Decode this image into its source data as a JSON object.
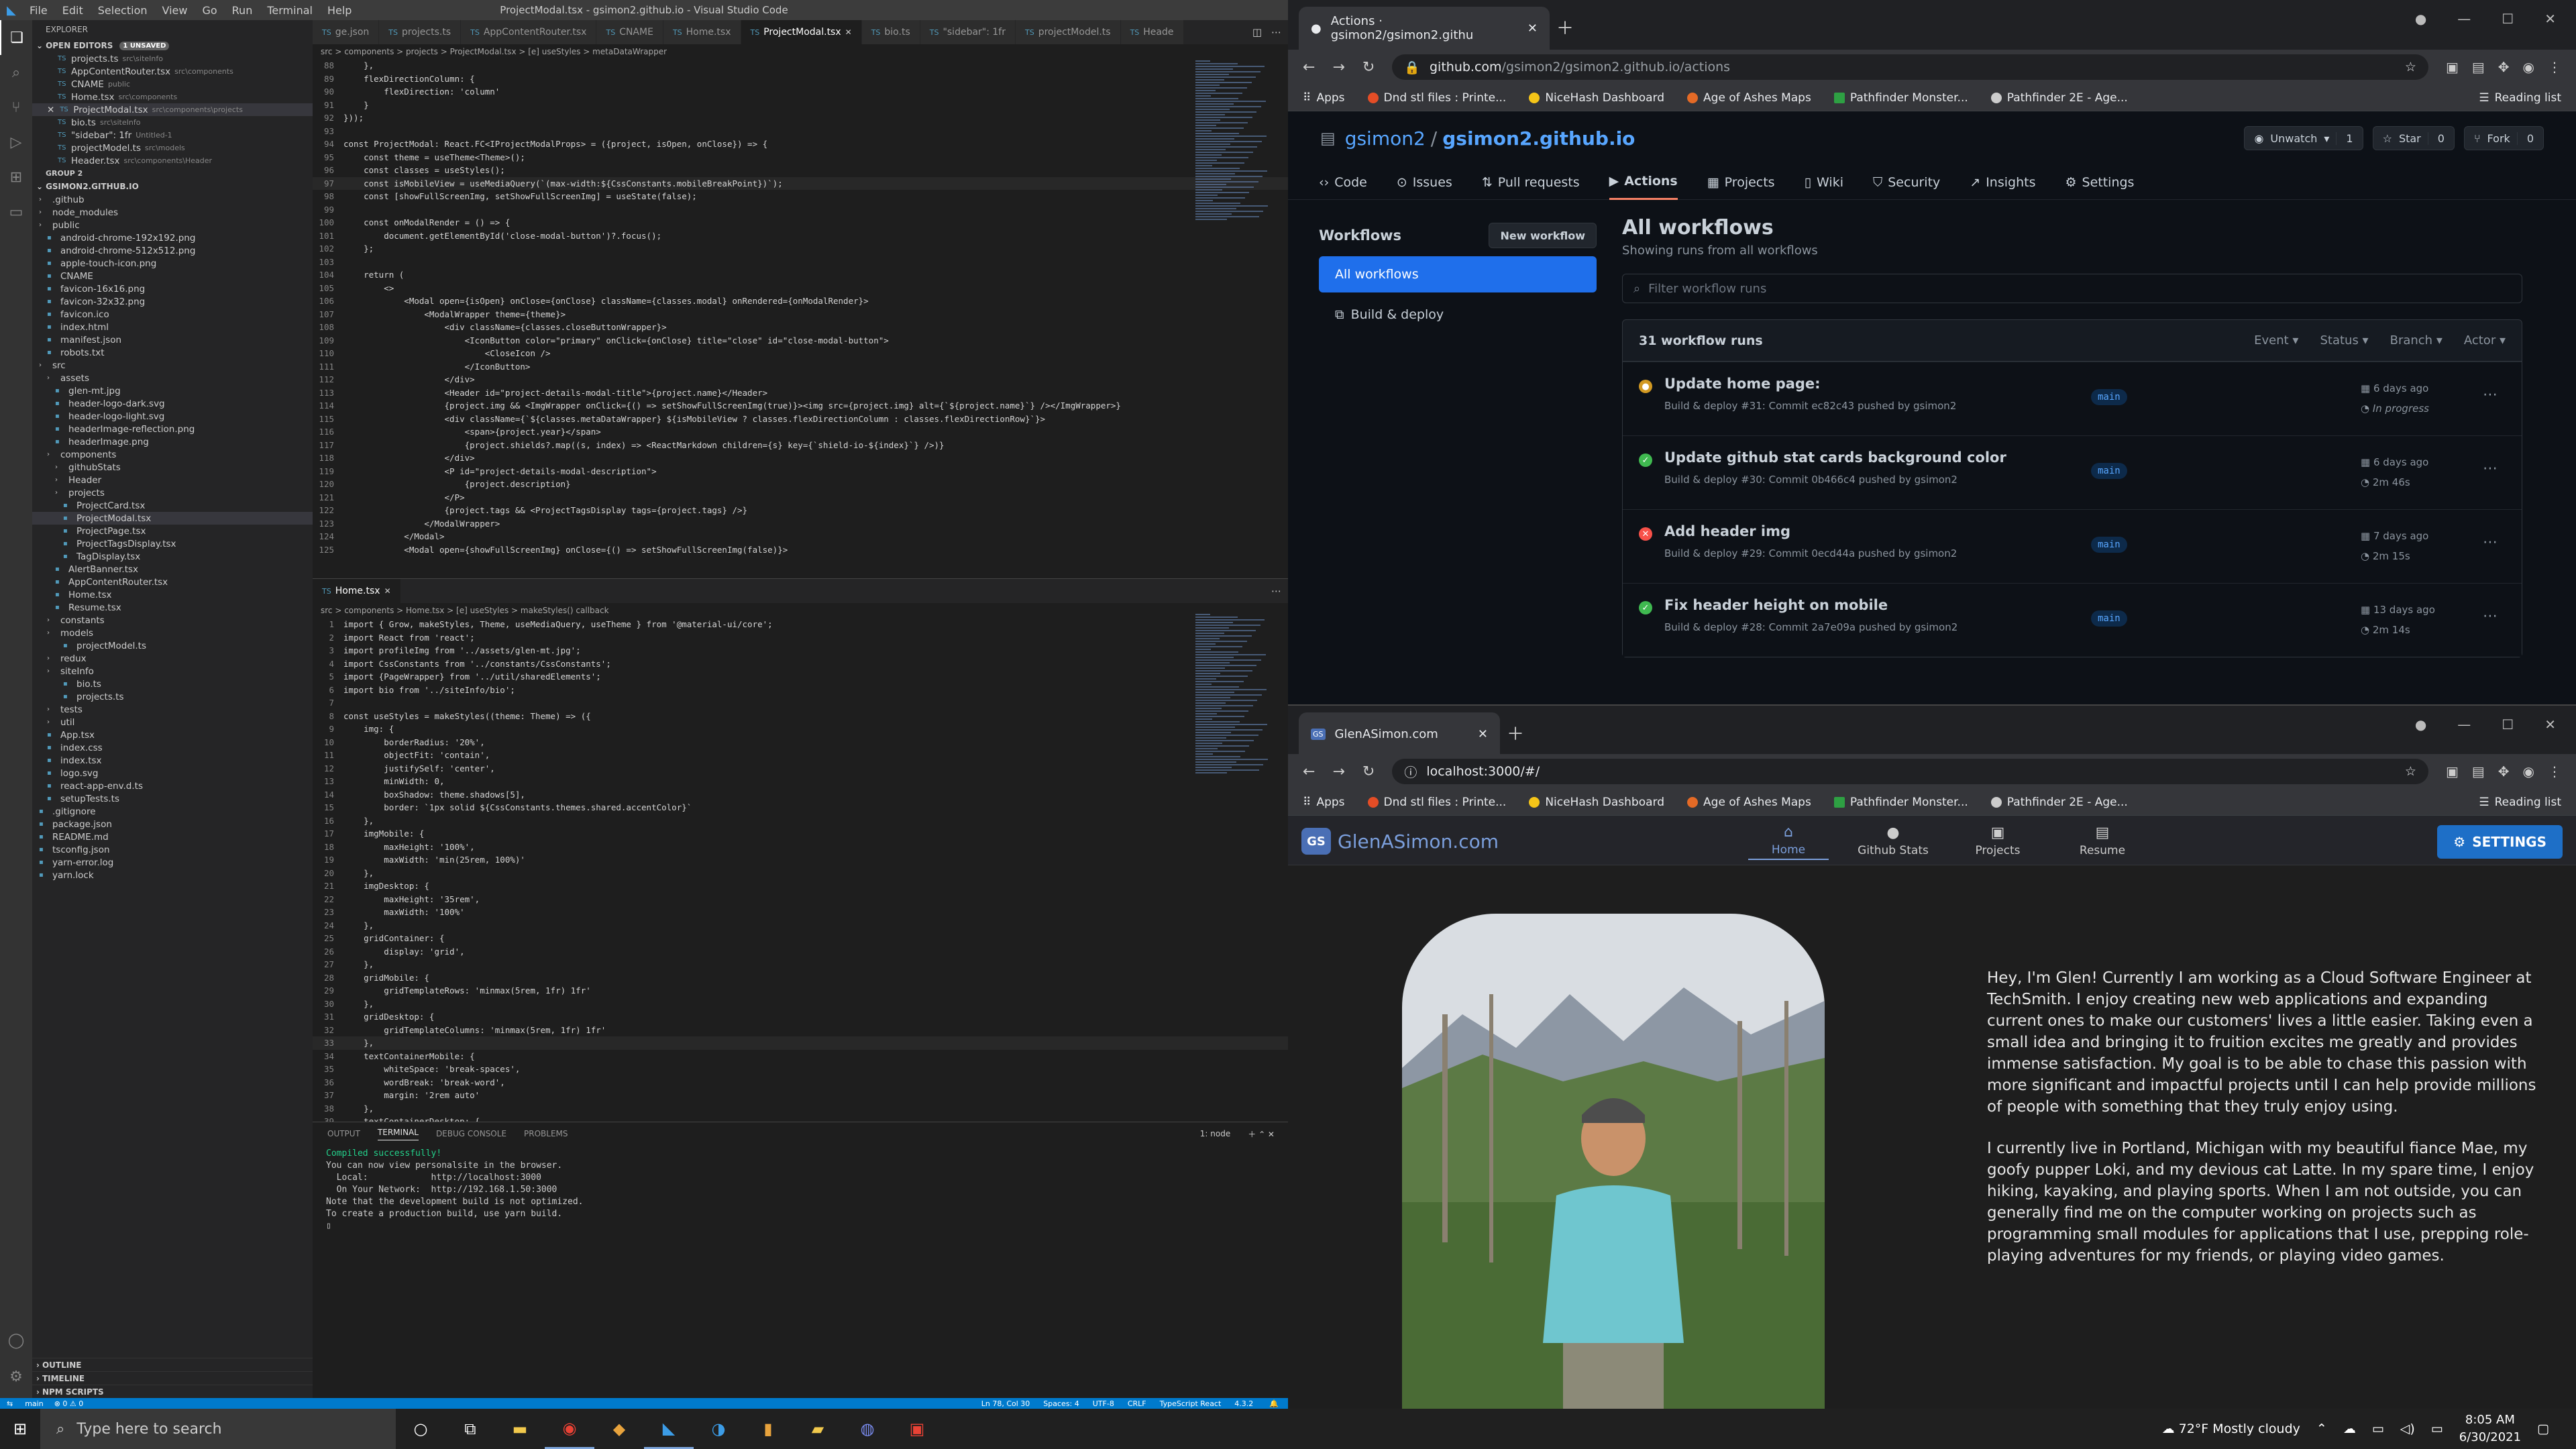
{
  "vscode": {
    "title": "ProjectModal.tsx - gsimon2.github.io - Visual Studio Code",
    "menu": [
      "File",
      "Edit",
      "Selection",
      "View",
      "Go",
      "Run",
      "Terminal",
      "Help"
    ],
    "explorer": "EXPLORER",
    "open_editors": "OPEN EDITORS",
    "unsaved": "1 UNSAVED",
    "open_files": [
      {
        "name": "projects.ts",
        "dir": "src\\siteInfo"
      },
      {
        "name": "AppContentRouter.tsx",
        "dir": "src\\components"
      },
      {
        "name": "CNAME",
        "dir": "public"
      },
      {
        "name": "Home.tsx",
        "dir": "src\\components"
      },
      {
        "name": "ProjectModal.tsx",
        "dir": "src\\components\\projects"
      },
      {
        "name": "bio.ts",
        "dir": "src\\siteInfo"
      },
      {
        "name": "\"sidebar\": 1fr",
        "dir": "Untitled-1"
      },
      {
        "name": "projectModel.ts",
        "dir": "src\\models"
      },
      {
        "name": "Header.tsx",
        "dir": "src\\components\\Header"
      }
    ],
    "group2": "GROUP 2",
    "repo": "GSIMON2.GITHUB.IO",
    "tree": [
      ".github",
      "node_modules",
      "public",
      "android-chrome-192x192.png",
      "android-chrome-512x512.png",
      "apple-touch-icon.png",
      "CNAME",
      "favicon-16x16.png",
      "favicon-32x32.png",
      "favicon.ico",
      "index.html",
      "manifest.json",
      "robots.txt",
      "src",
      "assets",
      "glen-mt.jpg",
      "header-logo-dark.svg",
      "header-logo-light.svg",
      "headerImage-reflection.png",
      "headerImage.png",
      "components",
      "githubStats",
      "Header",
      "projects",
      "ProjectCard.tsx",
      "ProjectModal.tsx",
      "ProjectPage.tsx",
      "ProjectTagsDisplay.tsx",
      "TagDisplay.tsx",
      "AlertBanner.tsx",
      "AppContentRouter.tsx",
      "Home.tsx",
      "Resume.tsx",
      "constants",
      "models",
      "projectModel.ts",
      "redux",
      "siteInfo",
      "bio.ts",
      "projects.ts",
      "tests",
      "util",
      "App.tsx",
      "index.css",
      "index.tsx",
      "logo.svg",
      "react-app-env.d.ts",
      "setupTests.ts",
      ".gitignore",
      "package.json",
      "README.md",
      "tsconfig.json",
      "yarn-error.log",
      "yarn.lock"
    ],
    "outline": "OUTLINE",
    "timeline": "TIMELINE",
    "npm": "NPM SCRIPTS",
    "tabs1": [
      "ge.json",
      "projects.ts",
      "AppContentRouter.tsx",
      "CNAME",
      "Home.tsx",
      "ProjectModal.tsx",
      "bio.ts",
      "\"sidebar\": 1fr",
      "projectModel.ts",
      "Heade"
    ],
    "crumb1": "src > components > projects > ProjectModal.tsx > [e] useStyles > metaDataWrapper",
    "code1_start": 88,
    "code1": [
      "    },",
      "    flexDirectionColumn: {",
      "        flexDirection: 'column'",
      "    }",
      "}));",
      "",
      "const ProjectModal: React.FC<IProjectModalProps> = ({project, isOpen, onClose}) => {",
      "    const theme = useTheme<Theme>();",
      "    const classes = useStyles();",
      "    const isMobileView = useMediaQuery(`(max-width:${CssConstants.mobileBreakPoint})`);",
      "    const [showFullScreenImg, setShowFullScreenImg] = useState(false);",
      "",
      "    const onModalRender = () => {",
      "        document.getElementById('close-modal-button')?.focus();",
      "    };",
      "",
      "    return (",
      "        <>",
      "            <Modal open={isOpen} onClose={onClose} className={classes.modal} onRendered={onModalRender}>",
      "                <ModalWrapper theme={theme}>",
      "                    <div className={classes.closeButtonWrapper}>",
      "                        <IconButton color=\"primary\" onClick={onClose} title=\"close\" id=\"close-modal-button\">",
      "                            <CloseIcon />",
      "                        </IconButton>",
      "                    </div>",
      "                    <Header id=\"project-details-modal-title\">{project.name}</Header>",
      "                    {project.img && <ImgWrapper onClick={() => setShowFullScreenImg(true)}><img src={project.img} alt={`${project.name}`} /></ImgWrapper>}",
      "                    <div className={`${classes.metaDataWrapper} ${isMobileView ? classes.flexDirectionColumn : classes.flexDirectionRow}`}>",
      "                        <span>{project.year}</span>",
      "                        {project.shields?.map((s, index) => <ReactMarkdown children={s} key={`shield-io-${index}`} />)}",
      "                    </div>",
      "                    <P id=\"project-details-modal-description\">",
      "                        {project.description}",
      "                    </P>",
      "                    {project.tags && <ProjectTagsDisplay tags={project.tags} />}",
      "                </ModalWrapper>",
      "            </Modal>",
      "            <Modal open={showFullScreenImg} onClose={() => setShowFullScreenImg(false)}>"
    ],
    "tab2": "Home.tsx",
    "crumb2": "src > components > Home.tsx > [e] useStyles > makeStyles() callback",
    "code2_start": 1,
    "code2": [
      "import { Grow, makeStyles, Theme, useMediaQuery, useTheme } from '@material-ui/core';",
      "import React from 'react';",
      "import profileImg from '../assets/glen-mt.jpg';",
      "import CssConstants from '../constants/CssConstants';",
      "import {PageWrapper} from '../util/sharedElements';",
      "import bio from '../siteInfo/bio';",
      "",
      "const useStyles = makeStyles((theme: Theme) => ({",
      "    img: {",
      "        borderRadius: '20%',",
      "        objectFit: 'contain',",
      "        justifySelf: 'center',",
      "        minWidth: 0,",
      "        boxShadow: theme.shadows[5],",
      "        border: `1px solid ${CssConstants.themes.shared.accentColor}`",
      "    },",
      "    imgMobile: {",
      "        maxHeight: '100%',",
      "        maxWidth: 'min(25rem, 100%)'",
      "    },",
      "    imgDesktop: {",
      "        maxHeight: '35rem',",
      "        maxWidth: '100%'",
      "    },",
      "    gridContainer: {",
      "        display: 'grid',",
      "    },",
      "    gridMobile: {",
      "        gridTemplateRows: 'minmax(5rem, 1fr) 1fr'",
      "    },",
      "    gridDesktop: {",
      "        gridTemplateColumns: 'minmax(5rem, 1fr) 1fr'",
      "    },",
      "    textContainerMobile: {",
      "        whiteSpace: 'break-spaces',",
      "        wordBreak: 'break-word',",
      "        margin: '2rem auto'",
      "    },",
      "    textContainerDesktop: {"
    ],
    "panel_tabs": [
      "OUTPUT",
      "TERMINAL",
      "DEBUG CONSOLE",
      "PROBLEMS"
    ],
    "panel_shell": "1: node",
    "terminal": [
      "Compiled successfully!",
      "",
      "You can now view personalsite in the browser.",
      "",
      "  Local:            http://localhost:3000",
      "  On Your Network:  http://192.168.1.50:3000",
      "",
      "Note that the development build is not optimized.",
      "To create a production build, use yarn build.",
      "",
      "▯"
    ],
    "status_left": [
      "main",
      "⊗ 0 ⚠ 0"
    ],
    "status_right": [
      "Ln 78, Col 30",
      "Spaces: 4",
      "UTF-8",
      "CRLF",
      "TypeScript React",
      "4.3.2"
    ]
  },
  "github": {
    "tab_title": "Actions · gsimon2/gsimon2.githu",
    "url_host": "github.com",
    "url_path": "/gsimon2/gsimon2.github.io/actions",
    "bookmarks": [
      "Apps",
      "Dnd stl files : Printe...",
      "NiceHash Dashboard",
      "Age of Ashes Maps",
      "Pathfinder Monster...",
      "Pathfinder 2E - Age..."
    ],
    "reading_list": "Reading list",
    "owner": "gsimon2",
    "repo": "gsimon2.github.io",
    "unwatch": "Unwatch",
    "watch_count": "1",
    "star": "Star",
    "star_count": "0",
    "fork": "Fork",
    "fork_count": "0",
    "nav": [
      "Code",
      "Issues",
      "Pull requests",
      "Actions",
      "Projects",
      "Wiki",
      "Security",
      "Insights",
      "Settings"
    ],
    "workflows_title": "Workflows",
    "new_workflow": "New workflow",
    "workflows": [
      "All workflows",
      "Build & deploy"
    ],
    "heading": "All workflows",
    "subheading": "Showing runs from all workflows",
    "filter_placeholder": "Filter workflow runs",
    "run_count": "31 workflow runs",
    "filters": [
      "Event",
      "Status",
      "Branch",
      "Actor"
    ],
    "runs": [
      {
        "title": "Update home page:",
        "sub": "Build & deploy #31: Commit ec82c43 pushed by gsimon2",
        "branch": "main",
        "date": "6 days ago",
        "dur": "In progress",
        "status": "progress"
      },
      {
        "title": "Update github stat cards background color",
        "sub": "Build & deploy #30: Commit 0b466c4 pushed by gsimon2",
        "branch": "main",
        "date": "6 days ago",
        "dur": "2m 46s",
        "status": "success"
      },
      {
        "title": "Add header img",
        "sub": "Build & deploy #29: Commit 0ecd44a pushed by gsimon2",
        "branch": "main",
        "date": "7 days ago",
        "dur": "2m 15s",
        "status": "fail"
      },
      {
        "title": "Fix header height on mobile",
        "sub": "Build & deploy #28: Commit 2a7e09a pushed by gsimon2",
        "branch": "main",
        "date": "13 days ago",
        "dur": "2m 14s",
        "status": "success"
      }
    ]
  },
  "portfolio": {
    "tab_title": "GlenASimon.com",
    "url": "localhost:3000/#/",
    "logo_mark": "GS",
    "logo_text": "GlenASimon.com",
    "nav": [
      "Home",
      "Github Stats",
      "Projects",
      "Resume"
    ],
    "settings": "SETTINGS",
    "bio1": "Hey, I'm Glen!  Currently I am working as a Cloud Software Engineer at TechSmith.  I enjoy creating new web applications and expanding current ones to make our customers' lives a little easier.  Taking even a small idea and bringing it to fruition excites me greatly and provides immense satisfaction.  My goal is to be able to chase this passion with more significant and impactful projects until I can help provide millions of people with something that they truly enjoy using.",
    "bio2": "I currently live in Portland, Michigan with my beautiful fiance Mae, my goofy pupper Loki, and my devious cat Latte.  In my spare time, I enjoy hiking, kayaking, and playing sports.  When I am not outside, you can generally find me on the computer working on projects such as programming small modules for applications that I use, prepping role-playing adventures for my friends, or playing video games."
  },
  "taskbar": {
    "search_placeholder": "Type here to search",
    "weather": "72°F  Mostly cloudy",
    "time": "8:05 AM",
    "date": "6/30/2021"
  }
}
